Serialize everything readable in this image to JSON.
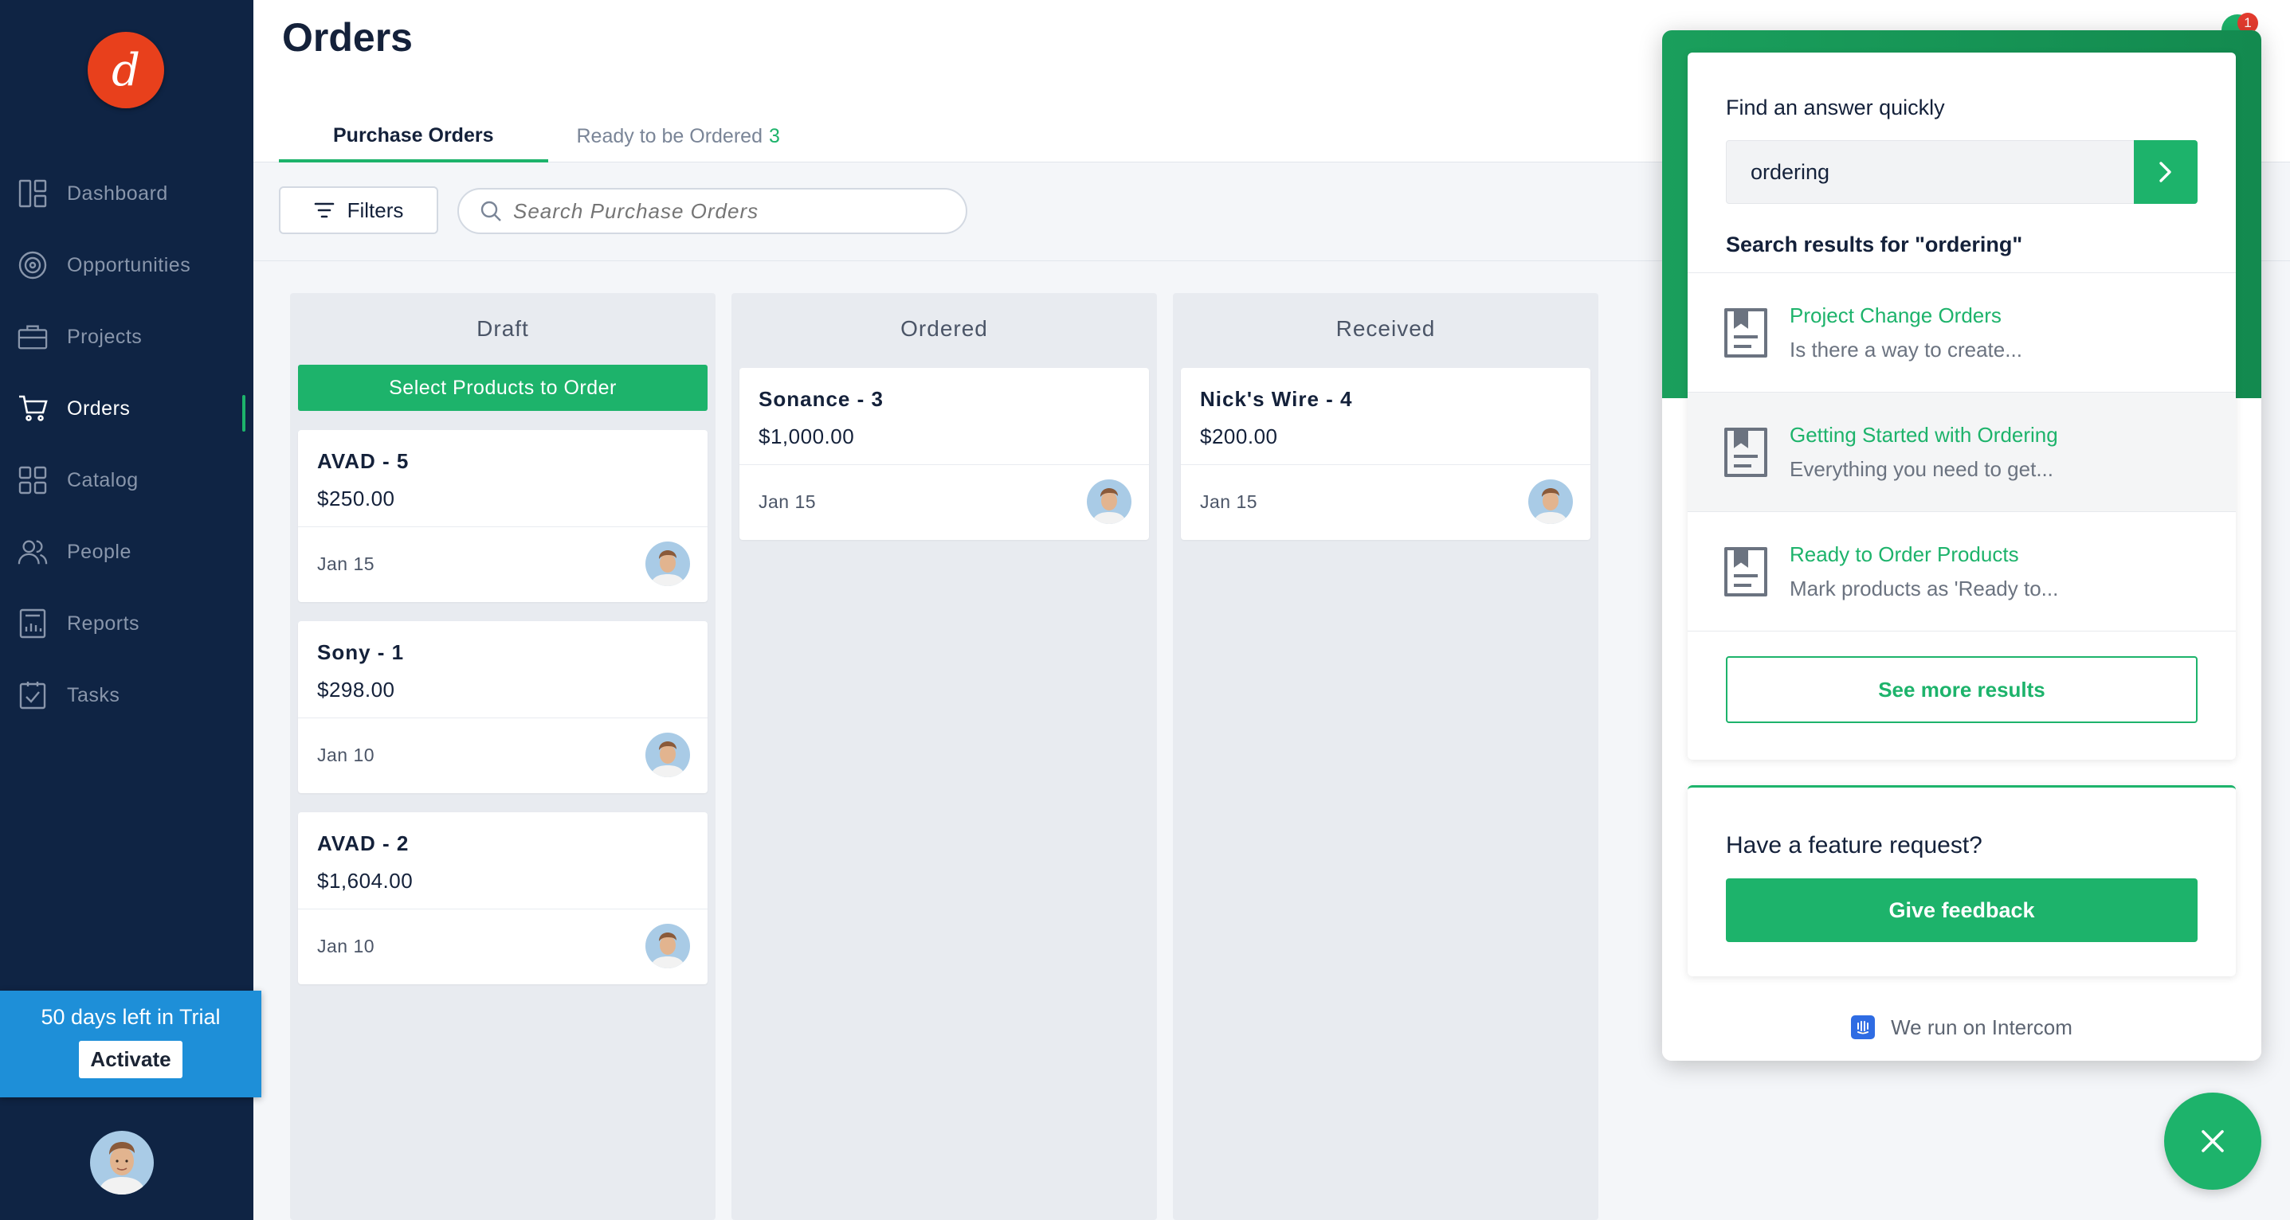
{
  "sidebar": {
    "logo_letter": "d",
    "items": [
      {
        "label": "Dashboard",
        "icon": "dashboard-icon"
      },
      {
        "label": "Opportunities",
        "icon": "target-icon"
      },
      {
        "label": "Projects",
        "icon": "briefcase-icon"
      },
      {
        "label": "Orders",
        "icon": "cart-icon",
        "active": true
      },
      {
        "label": "Catalog",
        "icon": "grid-icon"
      },
      {
        "label": "People",
        "icon": "people-icon"
      },
      {
        "label": "Reports",
        "icon": "report-icon"
      },
      {
        "label": "Tasks",
        "icon": "checklist-icon"
      }
    ],
    "trial": {
      "text": "50 days left in Trial",
      "button": "Activate"
    }
  },
  "header": {
    "title": "Orders",
    "tabs": [
      {
        "label": "Purchase Orders",
        "active": true
      },
      {
        "label": "Ready to be Ordered",
        "count": "3"
      }
    ]
  },
  "toolbar": {
    "filters_label": "Filters",
    "search_placeholder": "Search Purchase Orders"
  },
  "board": {
    "columns": [
      {
        "title": "Draft",
        "cta": "Select Products to Order",
        "cards": [
          {
            "name": "AVAD  -  5",
            "amount": "$250.00",
            "date": "Jan 15"
          },
          {
            "name": "Sony  -  1",
            "amount": "$298.00",
            "date": "Jan 10"
          },
          {
            "name": "AVAD  -  2",
            "amount": "$1,604.00",
            "date": "Jan 10"
          }
        ]
      },
      {
        "title": "Ordered",
        "cards": [
          {
            "name": "Sonance  -  3",
            "amount": "$1,000.00",
            "date": "Jan 15"
          }
        ]
      },
      {
        "title": "Received",
        "cards": [
          {
            "name": "Nick's Wire  -  4",
            "amount": "$200.00",
            "date": "Jan 15"
          }
        ]
      }
    ]
  },
  "intercom": {
    "badge_count": "1",
    "find_label": "Find an answer quickly",
    "search_value": "ordering",
    "results_title": "Search results for \"ordering\"",
    "results": [
      {
        "title": "Project Change Orders",
        "snippet": "Is there a way to create..."
      },
      {
        "title": "Getting Started with Ordering",
        "snippet": "Everything you need to get..."
      },
      {
        "title": "Ready to Order Products",
        "snippet": "Mark products as 'Ready to..."
      }
    ],
    "more_results": "See more results",
    "feature_prompt": "Have a feature request?",
    "feedback_button": "Give feedback",
    "footer": "We run on Intercom"
  },
  "colors": {
    "sidebar_bg": "#0f2444",
    "accent_green": "#1db36b",
    "trial_blue": "#1e8fd8",
    "logo_red": "#e8401c"
  }
}
